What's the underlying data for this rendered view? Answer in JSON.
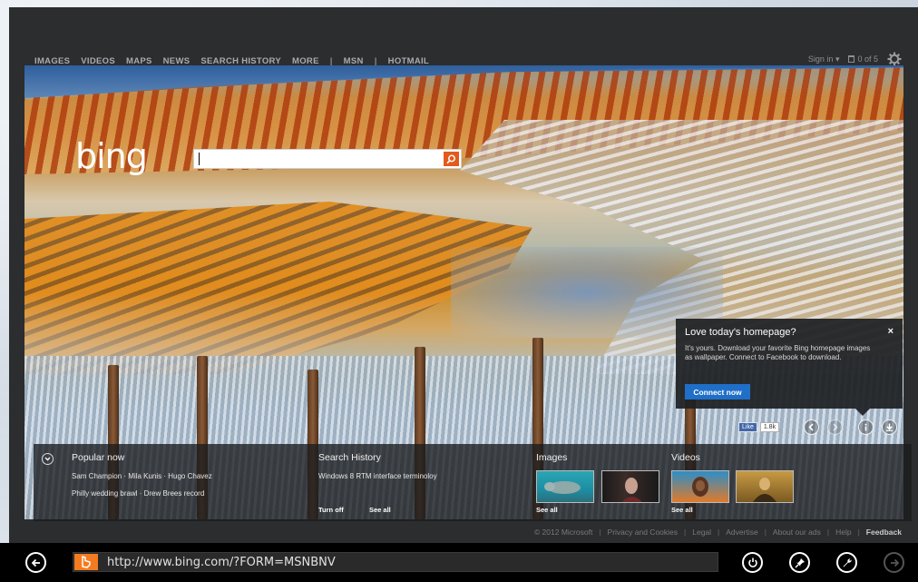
{
  "nav": {
    "items": [
      "IMAGES",
      "VIDEOS",
      "MAPS",
      "NEWS",
      "SEARCH HISTORY",
      "MORE"
    ],
    "separator": "|",
    "links": [
      "MSN",
      "HOTMAIL"
    ]
  },
  "account": {
    "signin": "Sign in ▾",
    "count": "0 of 5"
  },
  "logo": "bing",
  "search": {
    "value": "",
    "placeholder": ""
  },
  "popup": {
    "title": "Love today's homepage?",
    "close": "×",
    "body": "It's yours. Download your favorite Bing homepage images as wallpaper. Connect to Facebook to download.",
    "button": "Connect now"
  },
  "facebook": {
    "like": "Like",
    "count": "1.8k"
  },
  "strip": {
    "popular": {
      "title": "Popular now",
      "line1": "Sam Champion · Mila Kunis · Hugo Chavez",
      "line2": "Philly wedding brawl · Drew Brees record"
    },
    "history": {
      "title": "Search History",
      "line1": "Windows 8 RTM interface terminoloy",
      "turn_off": "Turn off",
      "see_all": "See all"
    },
    "images": {
      "title": "Images",
      "see_all": "See all"
    },
    "videos": {
      "title": "Videos",
      "see_all": "See all"
    }
  },
  "footer": {
    "copyright": "© 2012 Microsoft",
    "links": [
      "Privacy and Cookies",
      "Legal",
      "Advertise",
      "About our ads",
      "Help"
    ],
    "feedback": "Feedback"
  },
  "appbar": {
    "url": "http://www.bing.com/?FORM=MSNBNV"
  },
  "colors": {
    "accent": "#e35a1c",
    "connect": "#1f6fc9",
    "favicon": "#f47b20"
  }
}
